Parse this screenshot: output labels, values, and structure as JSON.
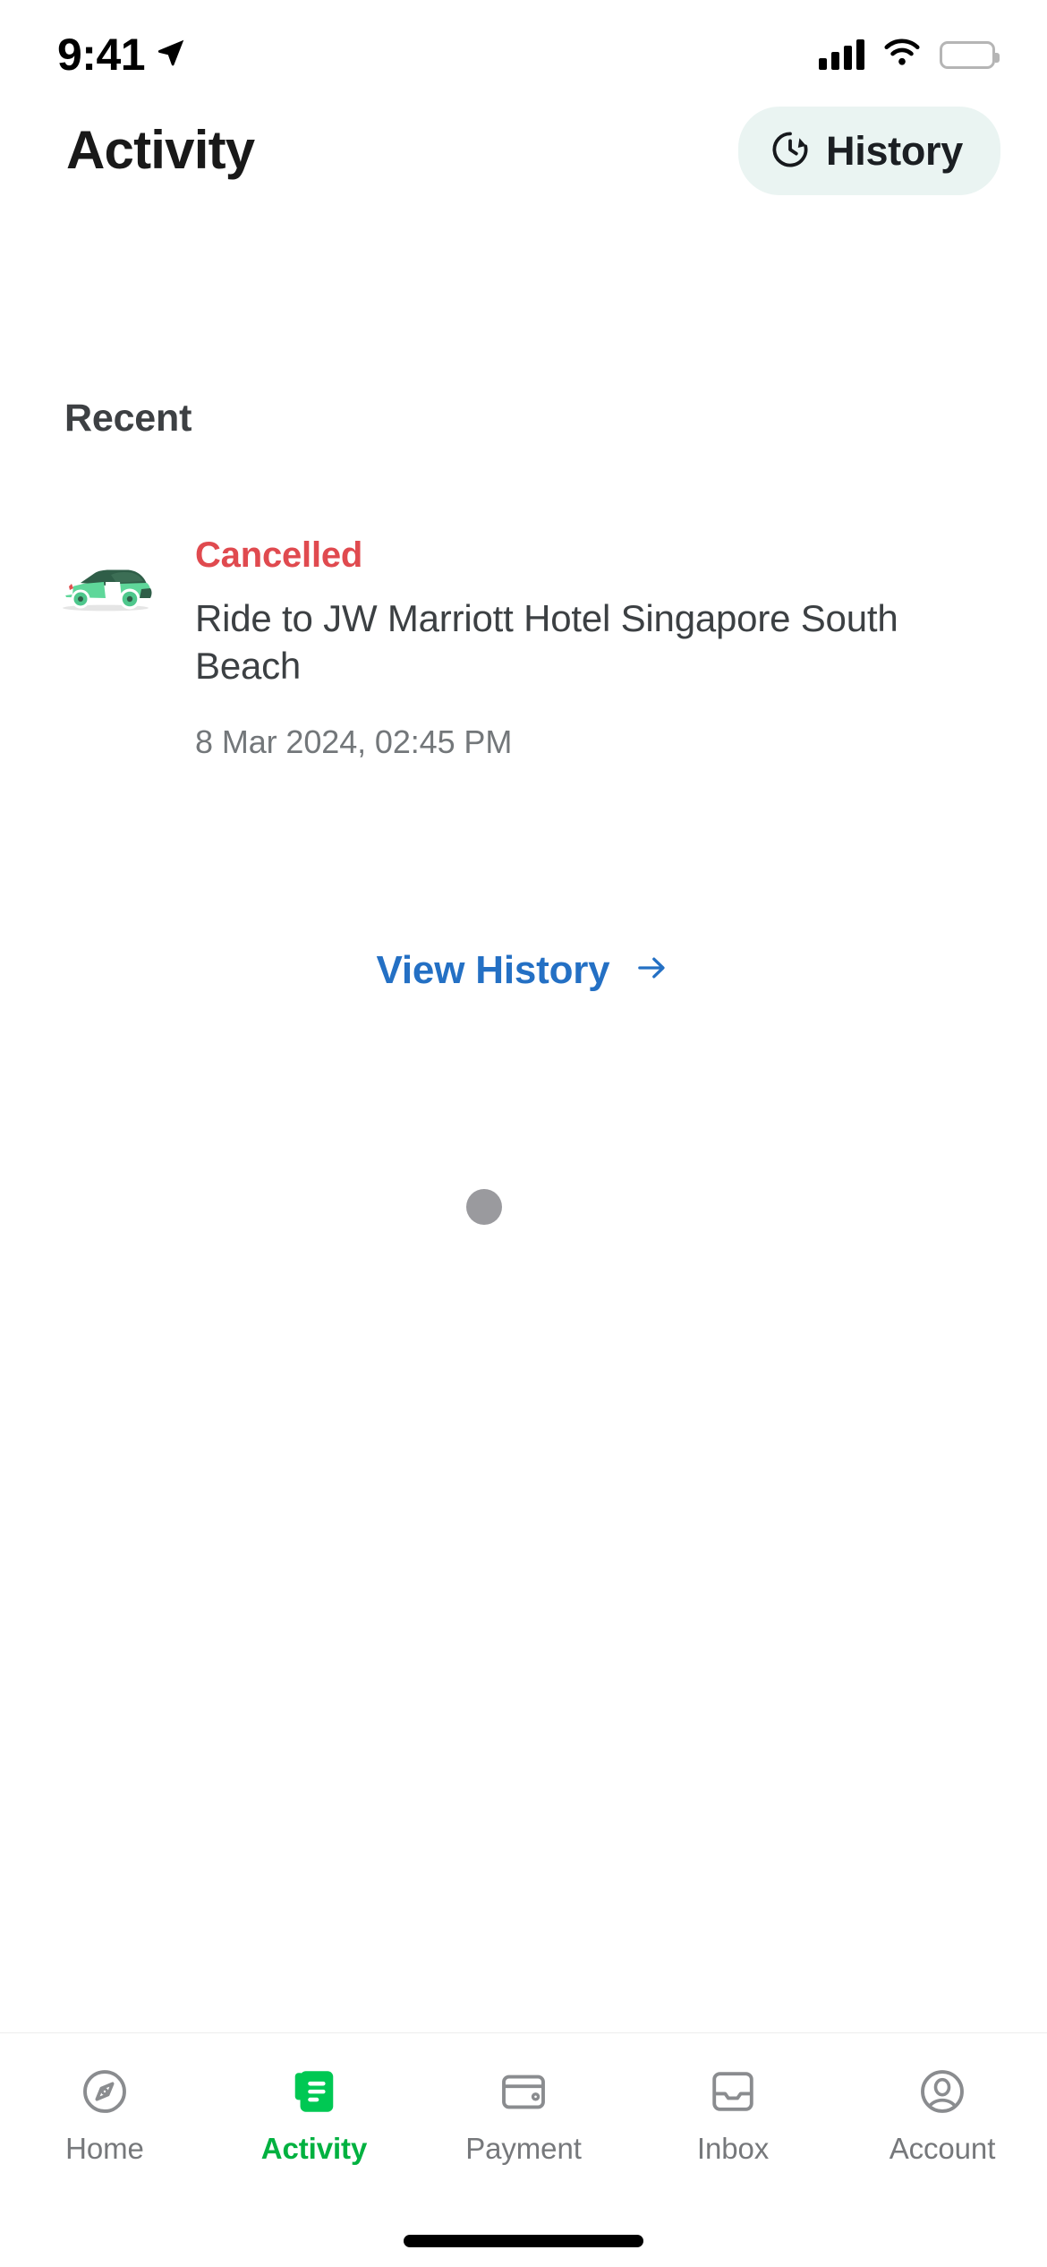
{
  "status_bar": {
    "time": "9:41",
    "location_icon": "location-arrow-icon",
    "signal_icon": "cellular-signal-icon",
    "wifi_icon": "wifi-icon",
    "battery_icon": "battery-full-icon"
  },
  "header": {
    "title": "Activity",
    "history_button": {
      "label": "History",
      "icon": "clock-history-icon",
      "background": "#eaf4f2"
    }
  },
  "main": {
    "section_title": "Recent",
    "ride": {
      "thumbnail_icon": "green-car-icon",
      "status": "Cancelled",
      "status_color": "#e04a4f",
      "title": "Ride to JW Marriott Hotel Singapore South Beach",
      "datetime": "8 Mar 2024, 02:45 PM"
    },
    "view_history": {
      "label": "View History",
      "arrow_icon": "arrow-right-icon",
      "color": "#2470c4"
    },
    "loading_indicator": {
      "icon": "loading-dot-icon",
      "color": "#9a9a9e"
    }
  },
  "tab_bar": {
    "active_color": "#00b140",
    "inactive_color": "#76787b",
    "items": [
      {
        "label": "Home",
        "icon": "compass-icon",
        "active": false
      },
      {
        "label": "Activity",
        "icon": "document-list-icon",
        "active": true
      },
      {
        "label": "Payment",
        "icon": "wallet-icon",
        "active": false
      },
      {
        "label": "Inbox",
        "icon": "inbox-tray-icon",
        "active": false
      },
      {
        "label": "Account",
        "icon": "user-circle-icon",
        "active": false
      }
    ]
  }
}
